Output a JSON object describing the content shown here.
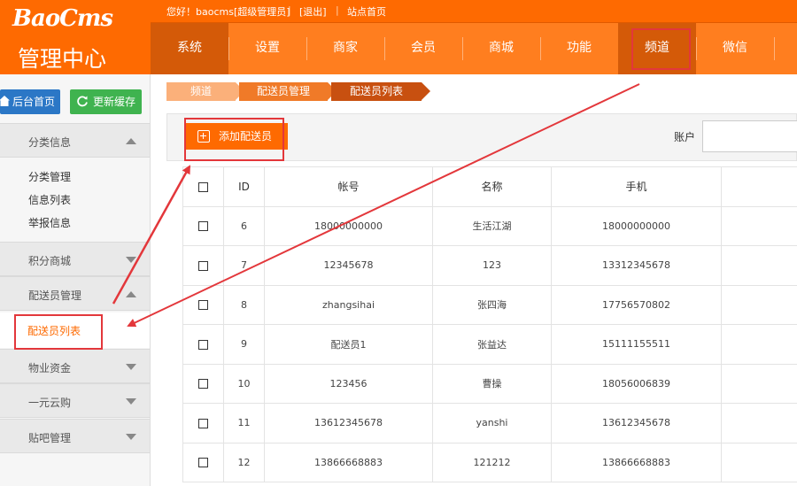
{
  "logo": {
    "brand": "BaoCms",
    "subtitle": "管理中心"
  },
  "topbar": {
    "greeting": "您好！baocms[超级管理员]",
    "logout": "[退出]",
    "site_home": "站点首页",
    "sep": "|"
  },
  "nav": {
    "items": [
      "系统",
      "设置",
      "商家",
      "会员",
      "商城",
      "功能",
      "频道",
      "微信"
    ],
    "active_index": 5
  },
  "sidebar": {
    "home_button": "后台首页",
    "cache_button": "更新缓存",
    "groups": [
      {
        "label": "分类信息",
        "expanded": true,
        "items": [
          "分类管理",
          "信息列表",
          "举报信息"
        ]
      },
      {
        "label": "积分商城",
        "expanded": false
      },
      {
        "label": "配送员管理",
        "expanded": true,
        "items": [
          "配送员列表"
        ]
      },
      {
        "label": "物业资金",
        "expanded": false
      },
      {
        "label": "一元云购",
        "expanded": false
      },
      {
        "label": "贴吧管理",
        "expanded": false
      }
    ]
  },
  "breadcrumb": [
    "频道",
    "配送员管理",
    "配送员列表"
  ],
  "toolbar": {
    "add_label": "添加配送员",
    "account_label": "账户",
    "account_value": "",
    "account_placeholder": ""
  },
  "table": {
    "columns": [
      "",
      "ID",
      "帐号",
      "名称",
      "手机",
      ""
    ],
    "rows": [
      {
        "id": "6",
        "account": "18000000000",
        "name": "生活江湖",
        "phone": "18000000000"
      },
      {
        "id": "7",
        "account": "12345678",
        "name": "123",
        "phone": "13312345678"
      },
      {
        "id": "8",
        "account": "zhangsihai",
        "name": "张四海",
        "phone": "17756570802"
      },
      {
        "id": "9",
        "account": "配送员1",
        "name": "张益达",
        "phone": "15111155511"
      },
      {
        "id": "10",
        "account": "123456",
        "name": "曹操",
        "phone": "18056006839"
      },
      {
        "id": "11",
        "account": "13612345678",
        "name": "yanshi",
        "phone": "13612345678"
      },
      {
        "id": "12",
        "account": "13866668883",
        "name": "121212",
        "phone": "13866668883"
      }
    ]
  },
  "colors": {
    "brand": "#fe6a01",
    "nav": "#ff7e1f",
    "nav_active": "#d45a08",
    "annotation": "#e3373b",
    "link": "#2626b7"
  }
}
